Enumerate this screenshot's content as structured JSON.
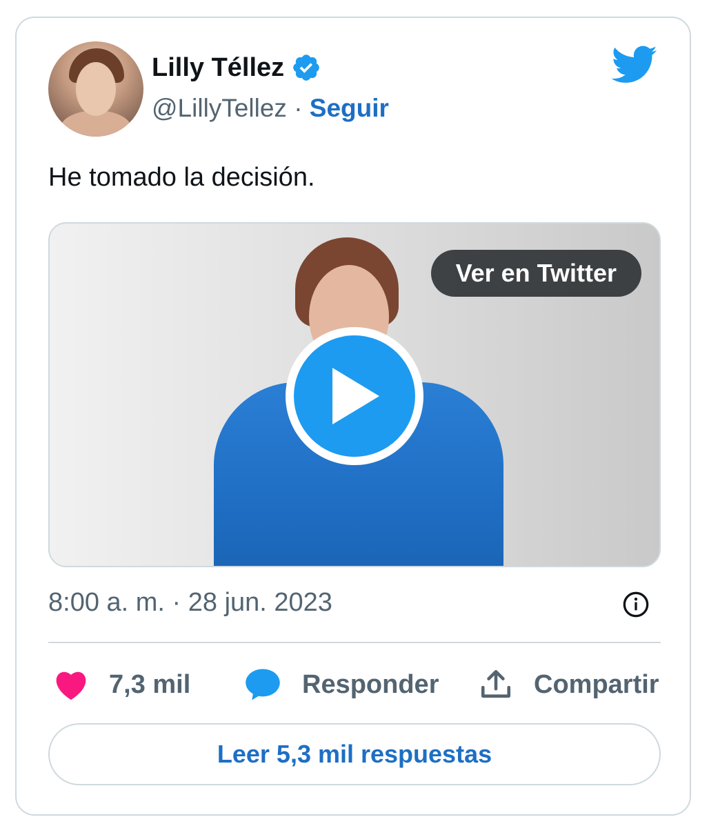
{
  "author": {
    "name": "Lilly Téllez",
    "handle": "@LillyTellez",
    "separator": "·",
    "follow_label": "Seguir"
  },
  "tweet": {
    "text": "He tomado la decisión.",
    "timestamp": "8:00 a. m. · 28 jun. 2023"
  },
  "media": {
    "view_on_twitter_label": "Ver en Twitter"
  },
  "actions": {
    "likes": "7,3 mil",
    "reply_label": "Responder",
    "share_label": "Compartir"
  },
  "read_replies_label": "Leer 5,3 mil respuestas",
  "colors": {
    "twitter_blue": "#1d9bf0",
    "link_blue": "#1d6fc4",
    "like_pink": "#f91880",
    "text_primary": "#0f1419",
    "text_secondary": "#536471",
    "border": "#cfd9de"
  },
  "icons": {
    "brand": "twitter-bird-icon",
    "verified": "verified-badge-icon",
    "play": "play-icon",
    "info": "info-icon",
    "like": "heart-icon",
    "reply": "speech-bubble-icon",
    "share": "share-upload-icon"
  }
}
